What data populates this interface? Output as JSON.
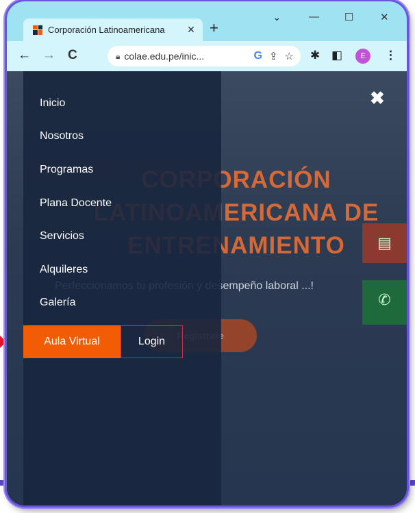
{
  "browser": {
    "tab_title": "Corporación Latinoamericana",
    "tab_close": "✕",
    "new_tab": "+",
    "window_controls": {
      "dropdown": "⌄",
      "minimize": "—",
      "maximize": "☐",
      "close": "✕"
    },
    "url": "colae.edu.pe/inic...",
    "google_icon": "G",
    "profile_initial": "E"
  },
  "page": {
    "hero_title": "CORPORACIÓN LATINOAMERICANA DE ENTRENAMIENTO",
    "hero_subtitle": "Perfeccionamos tu profesión y desempeño laboral ...!",
    "hero_button": "Regístrate"
  },
  "menu": {
    "items": [
      "Inicio",
      "Nosotros",
      "Programas",
      "Plana Docente",
      "Servicios",
      "Alquileres",
      "Galería"
    ],
    "aula_virtual": "Aula Virtual",
    "login": "Login",
    "close_icon": "✖"
  },
  "colors": {
    "accent": "#f25c05",
    "menu_bg": "#18263e",
    "titlebar": "#9fe3f2"
  }
}
